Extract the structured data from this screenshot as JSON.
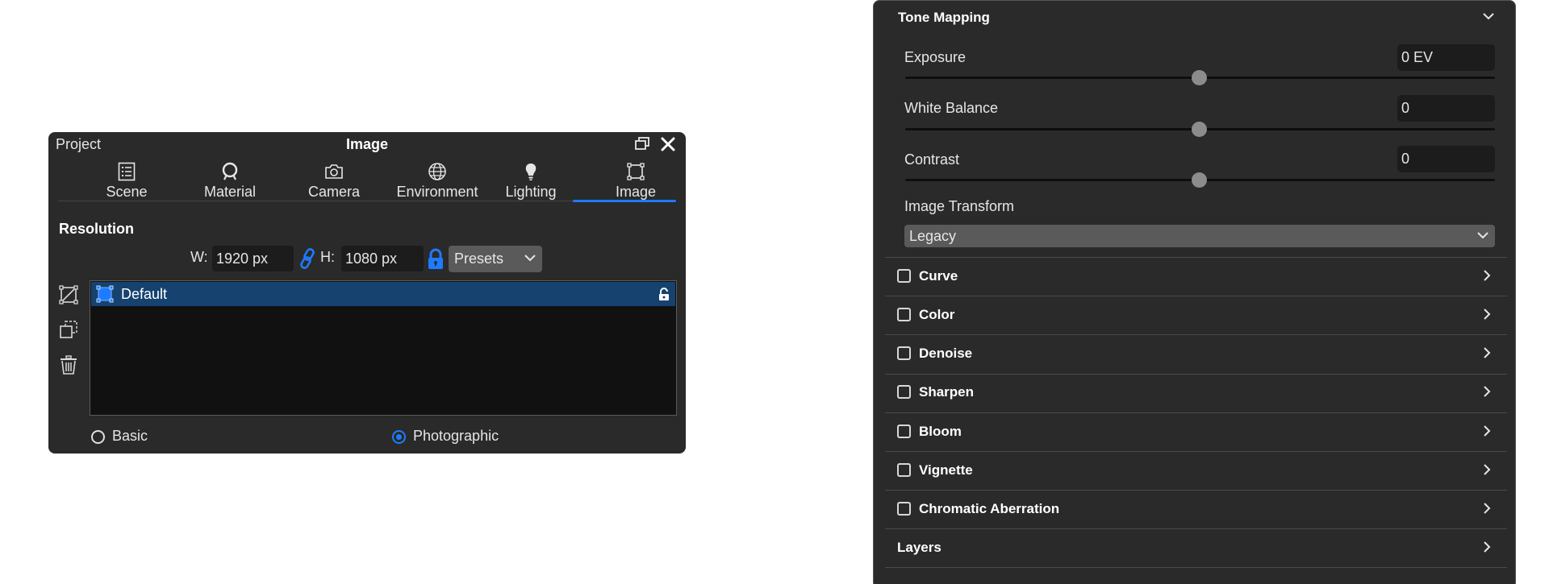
{
  "window": {
    "project_label": "Project",
    "title": "Image",
    "tabs": [
      {
        "label": "Scene",
        "icon": "list-icon"
      },
      {
        "label": "Material",
        "icon": "material-ball-icon"
      },
      {
        "label": "Camera",
        "icon": "camera-icon"
      },
      {
        "label": "Environment",
        "icon": "globe-icon"
      },
      {
        "label": "Lighting",
        "icon": "bulb-icon"
      },
      {
        "label": "Image",
        "icon": "frame-icon",
        "active": true
      }
    ],
    "resolution": {
      "section_title": "Resolution",
      "w_label": "W:",
      "w_value": "1920 px",
      "h_label": "H:",
      "h_value": "1080 px",
      "presets_label": "Presets"
    },
    "list": {
      "items": [
        {
          "label": "Default",
          "selected": true
        }
      ]
    },
    "modes": {
      "basic_label": "Basic",
      "photographic_label": "Photographic",
      "selected": "Photographic"
    }
  },
  "panel": {
    "tone_mapping": {
      "title": "Tone Mapping",
      "exposure_label": "Exposure",
      "exposure_value": "0 EV",
      "white_balance_label": "White Balance",
      "white_balance_value": "0",
      "contrast_label": "Contrast",
      "contrast_value": "0",
      "image_transform_label": "Image Transform",
      "image_transform_value": "Legacy"
    },
    "sections": [
      {
        "label": "Curve",
        "checked": false
      },
      {
        "label": "Color",
        "checked": false
      },
      {
        "label": "Denoise",
        "checked": false
      },
      {
        "label": "Sharpen",
        "checked": false
      },
      {
        "label": "Bloom",
        "checked": false
      },
      {
        "label": "Vignette",
        "checked": false
      },
      {
        "label": "Chromatic Aberration",
        "checked": false
      }
    ],
    "layers_label": "Layers"
  },
  "colors": {
    "accent": "#1d7bff",
    "panel_bg": "#2a2a2a",
    "selection": "#164270"
  }
}
